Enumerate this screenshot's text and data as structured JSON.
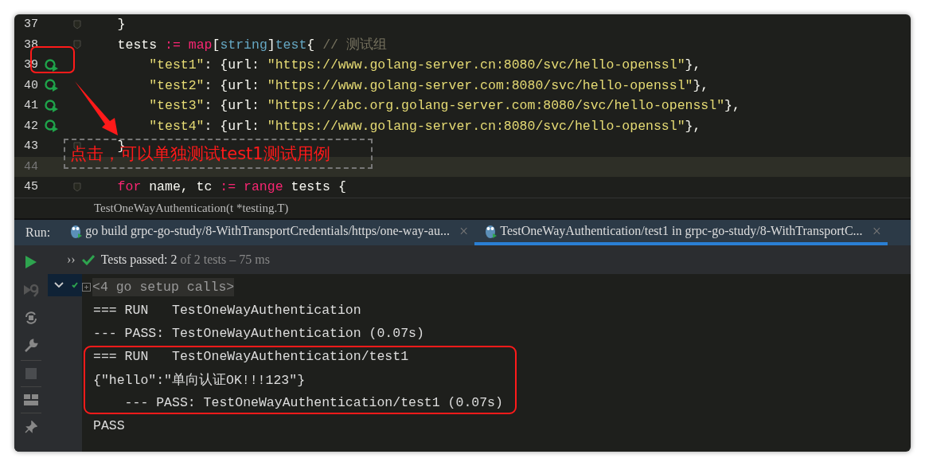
{
  "editor": {
    "lines": [
      {
        "number": "37",
        "run_icon": false,
        "fold": true,
        "current": false,
        "tokens": [
          {
            "kind": "plain",
            "text": "    }"
          }
        ]
      },
      {
        "number": "38",
        "run_icon": false,
        "fold": true,
        "current": false,
        "tokens": [
          {
            "kind": "plain",
            "text": "    tests "
          },
          {
            "kind": "op",
            "text": ":= "
          },
          {
            "kind": "keyword",
            "text": "map"
          },
          {
            "kind": "plain",
            "text": "["
          },
          {
            "kind": "type",
            "text": "string"
          },
          {
            "kind": "plain",
            "text": "]"
          },
          {
            "kind": "type",
            "text": "test"
          },
          {
            "kind": "plain",
            "text": "{ "
          },
          {
            "kind": "comment",
            "text": "// 测试组"
          }
        ]
      },
      {
        "number": "39",
        "run_icon": true,
        "fold": false,
        "current": false,
        "tokens": [
          {
            "kind": "string",
            "text": "        \"test1\""
          },
          {
            "kind": "plain",
            "text": ": {url: "
          },
          {
            "kind": "string",
            "text": "\"https://www.golang-server.cn:8080/svc/hello-openssl\""
          },
          {
            "kind": "plain",
            "text": "},"
          }
        ]
      },
      {
        "number": "40",
        "run_icon": true,
        "fold": false,
        "current": false,
        "tokens": [
          {
            "kind": "string",
            "text": "        \"test2\""
          },
          {
            "kind": "plain",
            "text": ": {url: "
          },
          {
            "kind": "string",
            "text": "\"https://www.golang-server.com:8080/svc/hello-openssl\""
          },
          {
            "kind": "plain",
            "text": "},"
          }
        ]
      },
      {
        "number": "41",
        "run_icon": true,
        "fold": false,
        "current": false,
        "tokens": [
          {
            "kind": "string",
            "text": "        \"test3\""
          },
          {
            "kind": "plain",
            "text": ": {url: "
          },
          {
            "kind": "string",
            "text": "\"https://abc.org.golang-server.com:8080/svc/hello-openssl\""
          },
          {
            "kind": "plain",
            "text": "},"
          }
        ]
      },
      {
        "number": "42",
        "run_icon": true,
        "fold": false,
        "current": false,
        "tokens": [
          {
            "kind": "string",
            "text": "        \"test4\""
          },
          {
            "kind": "plain",
            "text": ": {url: "
          },
          {
            "kind": "string",
            "text": "\"https://www.golang-server.cn:8080/svc/hello-openssl\""
          },
          {
            "kind": "plain",
            "text": "},"
          }
        ]
      },
      {
        "number": "43",
        "run_icon": false,
        "fold": true,
        "current": false,
        "tokens": [
          {
            "kind": "plain",
            "text": "    }"
          }
        ]
      },
      {
        "number": "44",
        "run_icon": false,
        "fold": false,
        "current": true
      },
      {
        "number": "45",
        "run_icon": false,
        "fold": true,
        "current": false,
        "tokens": [
          {
            "kind": "keyword",
            "text": "    for"
          },
          {
            "kind": "plain",
            "text": " name, tc "
          },
          {
            "kind": "op",
            "text": ":= "
          },
          {
            "kind": "keyword",
            "text": "range"
          },
          {
            "kind": "plain",
            "text": " tests {"
          }
        ]
      }
    ]
  },
  "breadcrumb": "TestOneWayAuthentication(t *testing.T)",
  "annotation": {
    "callout": "点击，可以单独测试test1测试用例"
  },
  "run_panel": {
    "label": "Run:",
    "tabs": [
      {
        "label": "go build grpc-go-study/8-WithTransportCredentials/https/one-way-au...",
        "close": "×",
        "selected": false
      },
      {
        "label": "TestOneWayAuthentication/test1 in grpc-go-study/8-WithTransportC...",
        "close": "×",
        "selected": true
      }
    ],
    "expand": "››",
    "status": {
      "passed": "Tests passed: 2",
      "detail": " of 2 tests – 75 ms"
    },
    "output": [
      {
        "kind": "setup",
        "text": "<4 go setup calls>"
      },
      {
        "kind": "normal",
        "text": "=== RUN   TestOneWayAuthentication"
      },
      {
        "kind": "normal",
        "text": "--- PASS: TestOneWayAuthentication (0.07s)"
      },
      {
        "kind": "normal",
        "text": "=== RUN   TestOneWayAuthentication/test1"
      },
      {
        "kind": "normal",
        "text": "{\"hello\":\"单向认证OK!!!123\"}"
      },
      {
        "kind": "normal",
        "text": "    --- PASS: TestOneWayAuthentication/test1 (0.07s)"
      },
      {
        "kind": "normal",
        "text": "PASS"
      }
    ]
  }
}
